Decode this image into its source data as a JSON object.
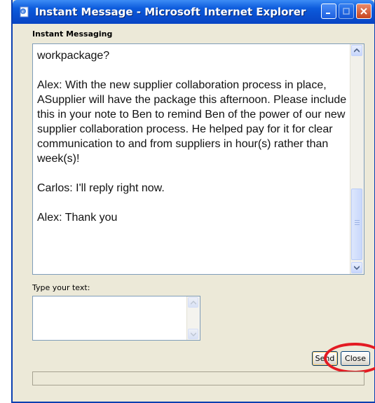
{
  "window": {
    "title": "Instant Message - Microsoft Internet Explorer"
  },
  "chat": {
    "section_label": "Instant Messaging",
    "lines": [
      "workpackage?",
      "Alex: With the new supplier collaboration process in place, ASupplier will have the package this afternoon.  Please include this in your note to Ben to remind Ben of the power of our new supplier collaboration process. He helped pay for it for clear communication to and from suppliers in hour(s) rather than week(s)!",
      "Carlos: I'll reply right now.",
      "Alex: Thank you"
    ]
  },
  "compose": {
    "label": "Type your text:",
    "value": ""
  },
  "buttons": {
    "send": "Send",
    "close": "Close"
  },
  "colors": {
    "titlebar": "#0a4fd0",
    "highlight_ring": "#e31b23"
  },
  "icons": {
    "window_icon": "ie-page-icon",
    "minimize": "minimize-icon",
    "maximize": "maximize-icon",
    "close": "close-icon"
  }
}
